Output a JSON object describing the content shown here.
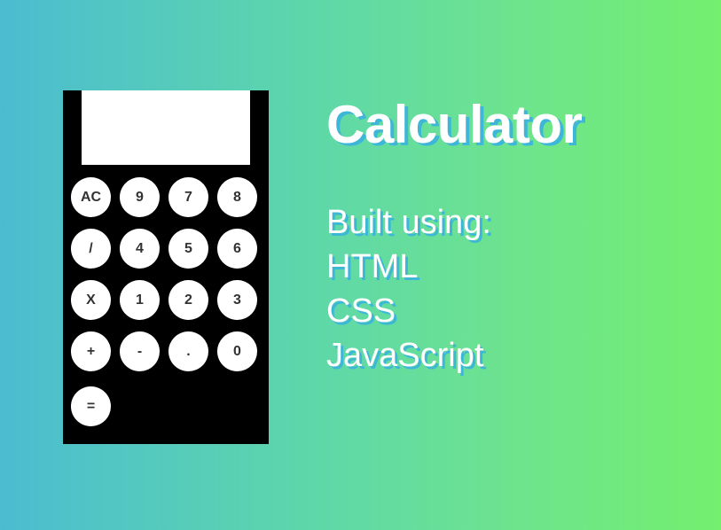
{
  "calculator": {
    "display": "",
    "keys": {
      "ac": "AC",
      "nine": "9",
      "seven": "7",
      "eight": "8",
      "divide": "/",
      "four": "4",
      "five": "5",
      "six": "6",
      "multiply": "X",
      "one": "1",
      "two": "2",
      "three": "3",
      "plus": "+",
      "minus": "-",
      "dot": ".",
      "zero": "0",
      "equals": "="
    }
  },
  "info": {
    "title": "Calculator",
    "built_heading": "Built using:",
    "technologies": [
      "HTML",
      "CSS",
      "JavaScript"
    ]
  },
  "colors": {
    "gradient_start": "#4bbcd1",
    "gradient_end": "#74ef6e",
    "text_shadow": "#3db6d8",
    "calculator_body": "#000000",
    "key_background": "#ffffff"
  }
}
